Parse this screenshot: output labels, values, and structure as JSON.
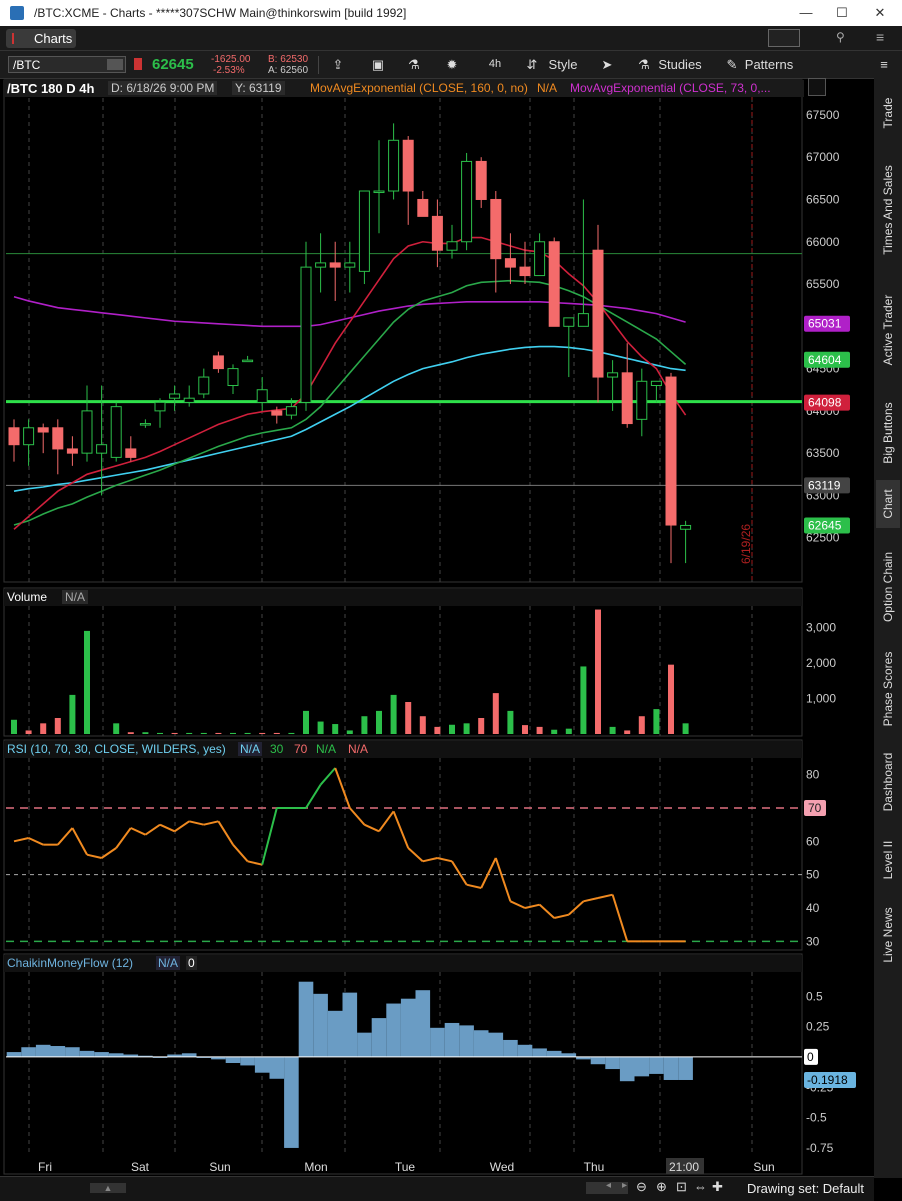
{
  "window": {
    "title": "/BTC:XCME - Charts - *****307SCHW Main@thinkorswim [build 1992]",
    "minimize": "—",
    "maximize": "☐",
    "close": "✕"
  },
  "tabs": {
    "charts_label": "Charts"
  },
  "toolbar": {
    "symbol": "/BTC",
    "last": "62645",
    "change": "-1625.00",
    "change_pct": "-2.53%",
    "bid": "B: 62530",
    "ask": "A: 62560",
    "timeframe": "4h",
    "style_label": "Style",
    "studies_label": "Studies",
    "patterns_label": "Patterns"
  },
  "sidebar": {
    "items": [
      "Trade",
      "Times And Sales",
      "Active Trader",
      "Big Buttons",
      "Chart",
      "Option Chain",
      "Phase Scores",
      "Dashboard",
      "Level II",
      "Live News"
    ],
    "active": "Chart"
  },
  "bottom": {
    "drawing_set": "Drawing set: Default"
  },
  "colors": {
    "up": "#2cbf4a",
    "down": "#f46b6b",
    "ema160": "#b020c8",
    "ema73": "#40d0f0",
    "ema_green": "#2aa84a",
    "ema_red": "#d0203c",
    "rsi": "#f08a20"
  },
  "chart_data": [
    {
      "type": "candlestick",
      "header": {
        "symbol": "/BTC 180 D 4h",
        "date": "D: 6/18/26 9:00 PM",
        "y": "Y: 63119",
        "study1": "MovAvgExponential (CLOSE, 160, 0, no)",
        "study1_value": "N/A",
        "study2": "MovAvgExponential (CLOSE, 73, 0,..."
      },
      "ylim": [
        62000,
        67700
      ],
      "y_ticks": [
        67500,
        67000,
        66500,
        66000,
        65500,
        65000,
        64500,
        64000,
        63500,
        63000,
        62500
      ],
      "x_labels": [
        "Fri",
        "Sat",
        "Sun",
        "Mon",
        "Tue",
        "Wed",
        "Thu",
        "21:00",
        "Sun"
      ],
      "date_annotation": "6/19/26",
      "price_labels": [
        {
          "text": "65031",
          "value": 65031,
          "color": "#b020c8"
        },
        {
          "text": "64604",
          "value": 64604,
          "color": "#2cbf4a"
        },
        {
          "text": "64098",
          "value": 64098,
          "color": "#d0203c"
        },
        {
          "text": "63119",
          "value": 63119,
          "color": "#444"
        },
        {
          "text": "62645",
          "value": 62645,
          "color": "#2cbf4a"
        }
      ],
      "horizontal_lines": [
        65860,
        64110,
        63119
      ],
      "candles": [
        [
          63800,
          63900,
          63400,
          63600
        ],
        [
          63600,
          63900,
          63350,
          63800
        ],
        [
          63800,
          63850,
          63500,
          63750
        ],
        [
          63800,
          63900,
          63250,
          63550
        ],
        [
          63550,
          63700,
          63350,
          63500
        ],
        [
          63500,
          64300,
          63400,
          64000
        ],
        [
          63500,
          64300,
          63000,
          63600
        ],
        [
          63450,
          64100,
          63400,
          64050
        ],
        [
          63550,
          63700,
          63400,
          63450
        ],
        [
          63850,
          63900,
          63800,
          63850
        ],
        [
          64000,
          64150,
          63800,
          64100
        ],
        [
          64150,
          64300,
          64000,
          64200
        ],
        [
          64100,
          64300,
          64050,
          64150
        ],
        [
          64200,
          64500,
          64150,
          64400
        ],
        [
          64650,
          64700,
          64450,
          64500
        ],
        [
          64300,
          64550,
          64200,
          64500
        ],
        [
          64600,
          64650,
          64600,
          64600
        ],
        [
          64100,
          64400,
          64000,
          64250
        ],
        [
          64000,
          64050,
          63850,
          63950
        ],
        [
          63950,
          64150,
          63900,
          64050
        ],
        [
          64100,
          66000,
          64000,
          65700
        ],
        [
          65700,
          66100,
          65400,
          65750
        ],
        [
          65750,
          66000,
          65300,
          65700
        ],
        [
          65700,
          66000,
          65400,
          65750
        ],
        [
          65650,
          66600,
          65500,
          66600
        ],
        [
          66600,
          67200,
          66100,
          66600
        ],
        [
          66600,
          67400,
          66500,
          67200
        ],
        [
          67200,
          67250,
          66200,
          66600
        ],
        [
          66500,
          66600,
          66300,
          66300
        ],
        [
          66300,
          66500,
          65700,
          65900
        ],
        [
          65900,
          66200,
          65800,
          66000
        ],
        [
          66000,
          67050,
          65900,
          66950
        ],
        [
          66950,
          67000,
          66400,
          66500
        ],
        [
          66500,
          66600,
          65400,
          65800
        ],
        [
          65800,
          66100,
          65500,
          65700
        ],
        [
          65700,
          66000,
          65500,
          65600
        ],
        [
          65600,
          66100,
          65600,
          66000
        ],
        [
          66000,
          66050,
          65000,
          65000
        ],
        [
          65000,
          65100,
          64400,
          65100
        ],
        [
          65000,
          66500,
          65000,
          65150
        ],
        [
          65900,
          66200,
          64100,
          64400
        ],
        [
          64400,
          64600,
          64000,
          64450
        ],
        [
          64450,
          64800,
          63800,
          63850
        ],
        [
          63900,
          64500,
          63700,
          64350
        ],
        [
          64300,
          64350,
          64100,
          64350
        ],
        [
          64400,
          64450,
          62200,
          62650
        ],
        [
          62600,
          62700,
          62200,
          62645
        ]
      ],
      "ema_red": [
        62600,
        62750,
        62900,
        63050,
        63150,
        63250,
        63300,
        63350,
        63400,
        63450,
        63520,
        63600,
        63680,
        63760,
        63840,
        63900,
        63960,
        63990,
        64010,
        64030,
        64200,
        64500,
        64800,
        65050,
        65300,
        65550,
        65800,
        65950,
        66000,
        65980,
        65980,
        66050,
        66050,
        66000,
        65950,
        65900,
        65880,
        65780,
        65620,
        65480,
        65280,
        65050,
        64820,
        64640,
        64500,
        64200,
        63950
      ],
      "ema_green": [
        62650,
        62700,
        62780,
        62850,
        62900,
        62980,
        63050,
        63120,
        63180,
        63240,
        63300,
        63370,
        63440,
        63510,
        63580,
        63640,
        63700,
        63740,
        63770,
        63800,
        63900,
        64050,
        64250,
        64450,
        64650,
        64850,
        65050,
        65200,
        65300,
        65350,
        65400,
        65480,
        65520,
        65530,
        65540,
        65530,
        65520,
        65480,
        65420,
        65350,
        65250,
        65150,
        65050,
        64950,
        64850,
        64700,
        64550
      ],
      "ema73": [
        63050,
        63080,
        63100,
        63130,
        63150,
        63180,
        63210,
        63240,
        63270,
        63300,
        63340,
        63380,
        63420,
        63460,
        63500,
        63540,
        63580,
        63620,
        63660,
        63700,
        63780,
        63870,
        63960,
        64050,
        64150,
        64250,
        64350,
        64430,
        64500,
        64540,
        64580,
        64630,
        64670,
        64700,
        64730,
        64750,
        64760,
        64760,
        64750,
        64730,
        64700,
        64660,
        64620,
        64580,
        64540,
        64500,
        64480
      ],
      "ema160": [
        65350,
        65300,
        65260,
        65220,
        65200,
        65180,
        65160,
        65140,
        65120,
        65100,
        65080,
        65060,
        65050,
        65040,
        65030,
        65020,
        65010,
        65000,
        65000,
        65000,
        65000,
        65020,
        65060,
        65100,
        65140,
        65180,
        65210,
        65240,
        65260,
        65270,
        65280,
        65290,
        65290,
        65290,
        65290,
        65290,
        65290,
        65280,
        65270,
        65260,
        65250,
        65230,
        65210,
        65180,
        65150,
        65100,
        65050
      ]
    },
    {
      "type": "bar",
      "title": "Volume",
      "title_value": "N/A",
      "ylim": [
        0,
        3600
      ],
      "y_ticks": [
        "3,000",
        "2,000",
        "1,000"
      ],
      "y_tick_values": [
        3000,
        2000,
        1000
      ],
      "values": [
        400,
        100,
        300,
        450,
        1100,
        2900,
        0,
        300,
        50,
        50,
        30,
        30,
        30,
        30,
        30,
        30,
        30,
        30,
        30,
        30,
        650,
        350,
        280,
        100,
        500,
        650,
        1100,
        900,
        500,
        200,
        260,
        300,
        450,
        1150,
        650,
        250,
        200,
        120,
        150,
        1900,
        3500,
        200,
        100,
        500,
        700,
        1950,
        300
      ],
      "colors": [
        "u",
        "d",
        "d",
        "d",
        "u",
        "u",
        "d",
        "u",
        "d",
        "u",
        "u",
        "d",
        "u",
        "u",
        "d",
        "u",
        "u",
        "d",
        "d",
        "u",
        "u",
        "u",
        "u",
        "u",
        "u",
        "u",
        "u",
        "d",
        "d",
        "d",
        "u",
        "u",
        "d",
        "d",
        "u",
        "d",
        "d",
        "u",
        "u",
        "u",
        "d",
        "u",
        "d",
        "d",
        "u",
        "d",
        "u"
      ]
    },
    {
      "type": "line",
      "title": "RSI (10, 70, 30, CLOSE, WILDERS, yes)",
      "title_values": [
        "N/A",
        "30",
        "70",
        "N/A",
        "N/A"
      ],
      "ylim": [
        28,
        85
      ],
      "y_ticks": [
        80,
        60,
        50,
        40,
        30
      ],
      "overbought": 70,
      "oversold": 30,
      "values": [
        60,
        61,
        59,
        59,
        64,
        56,
        55,
        58,
        64,
        62,
        65,
        63,
        66,
        65,
        66,
        59,
        54,
        53,
        70,
        70,
        70,
        77,
        82,
        70,
        65,
        63,
        69,
        58,
        54,
        55,
        54,
        47,
        46,
        55,
        42,
        40,
        41,
        37,
        38,
        42,
        43,
        44,
        30,
        30,
        30,
        30,
        30
      ]
    },
    {
      "type": "bar",
      "title": "ChaikinMoneyFlow (12)",
      "title_values": [
        "N/A",
        "0"
      ],
      "ylim": [
        -0.8,
        0.7
      ],
      "y_ticks": [
        "0.5",
        "0.25",
        "0",
        "-0.25",
        "-0.5",
        "-0.75"
      ],
      "y_tick_values": [
        0.5,
        0.25,
        0,
        -0.25,
        -0.5,
        -0.75
      ],
      "current_label": "-0.1918",
      "zero_label": "0",
      "values": [
        0.04,
        0.08,
        0.1,
        0.09,
        0.08,
        0.05,
        0.04,
        0.03,
        0.02,
        0.01,
        0.0,
        0.02,
        0.03,
        0.0,
        -0.02,
        -0.05,
        -0.07,
        -0.13,
        -0.18,
        -0.75,
        0.62,
        0.52,
        0.38,
        0.53,
        0.2,
        0.32,
        0.44,
        0.48,
        0.55,
        0.24,
        0.28,
        0.26,
        0.22,
        0.2,
        0.14,
        0.1,
        0.07,
        0.05,
        0.03,
        -0.02,
        -0.06,
        -0.1,
        -0.2,
        -0.16,
        -0.14,
        -0.19,
        -0.19
      ]
    }
  ]
}
